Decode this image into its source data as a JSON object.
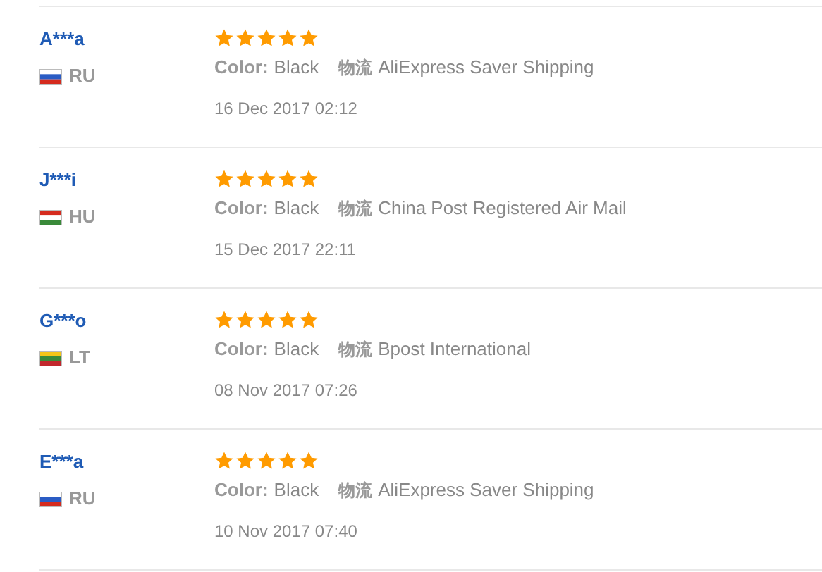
{
  "reviews": [
    {
      "name": "A***a",
      "country": "RU",
      "flag": {
        "kind": "whitebluered"
      },
      "stars": 5,
      "color_label": "Color:",
      "color_value": "Black",
      "shipping_label": "物流",
      "shipping_value": "AliExpress Saver Shipping",
      "date": "16 Dec 2017 02:12"
    },
    {
      "name": "J***i",
      "country": "HU",
      "flag": {
        "kind": "redwhitegreen"
      },
      "stars": 5,
      "color_label": "Color:",
      "color_value": "Black",
      "shipping_label": "物流",
      "shipping_value": "China Post Registered Air Mail",
      "date": "15 Dec 2017 22:11"
    },
    {
      "name": "G***o",
      "country": "LT",
      "flag": {
        "kind": "yellowgreenred"
      },
      "stars": 5,
      "color_label": "Color:",
      "color_value": "Black",
      "shipping_label": "物流",
      "shipping_value": "Bpost International",
      "date": "08 Nov 2017 07:26"
    },
    {
      "name": "E***a",
      "country": "RU",
      "flag": {
        "kind": "whitebluered"
      },
      "stars": 5,
      "color_label": "Color:",
      "color_value": "Black",
      "shipping_label": "物流",
      "shipping_value": "AliExpress Saver Shipping",
      "date": "10 Nov 2017 07:40"
    }
  ]
}
